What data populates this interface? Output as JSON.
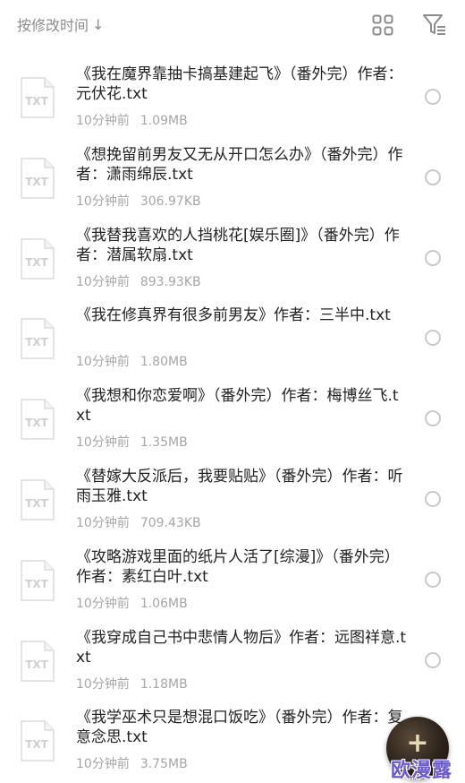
{
  "toolbar": {
    "sort_label": "按修改时间",
    "sort_arrow": "↓",
    "grid_icon": "grid-view-icon",
    "filter_icon": "filter-icon"
  },
  "files": [
    {
      "title": "《我在魔界靠抽卡搞基建起飞》（番外完）作者：元伏花.txt",
      "time": "10分钟前",
      "size": "1.09MB",
      "icon_label": "TXT"
    },
    {
      "title": "《想挽留前男友又无从开口怎么办》（番外完）作者：潇雨绵辰.txt",
      "time": "10分钟前",
      "size": "306.97KB",
      "icon_label": "TXT"
    },
    {
      "title": "《我替我喜欢的人挡桃花[娱乐圈]》（番外完）作者：潜属软扇.txt",
      "time": "10分钟前",
      "size": "893.93KB",
      "icon_label": "TXT"
    },
    {
      "title": "《我在修真界有很多前男友》作者：三半中.txt",
      "time": "10分钟前",
      "size": "1.80MB",
      "icon_label": "TXT"
    },
    {
      "title": "《我想和你恋爱啊》（番外完）作者：梅博丝飞.txt",
      "time": "10分钟前",
      "size": "1.35MB",
      "icon_label": "TXT"
    },
    {
      "title": "《替嫁大反派后，我要贴贴》（番外完）作者：听雨玉雅.txt",
      "time": "10分钟前",
      "size": "709.43KB",
      "icon_label": "TXT"
    },
    {
      "title": "《攻略游戏里面的纸片人活了[综漫]》（番外完）作者：素红白叶.txt",
      "time": "10分钟前",
      "size": "1.06MB",
      "icon_label": "TXT"
    },
    {
      "title": "《我穿成自己书中悲情人物后》作者：远图祥意.txt",
      "time": "10分钟前",
      "size": "1.18MB",
      "icon_label": "TXT"
    },
    {
      "title": "《我学巫术只是想混口饭吃》（番外完）作者：复意念思.txt",
      "time": "10分钟前",
      "size": "3.75MB",
      "icon_label": "TXT"
    }
  ],
  "fab": {
    "label": "+",
    "icon": "add-icon"
  },
  "watermark": "欧漫露"
}
